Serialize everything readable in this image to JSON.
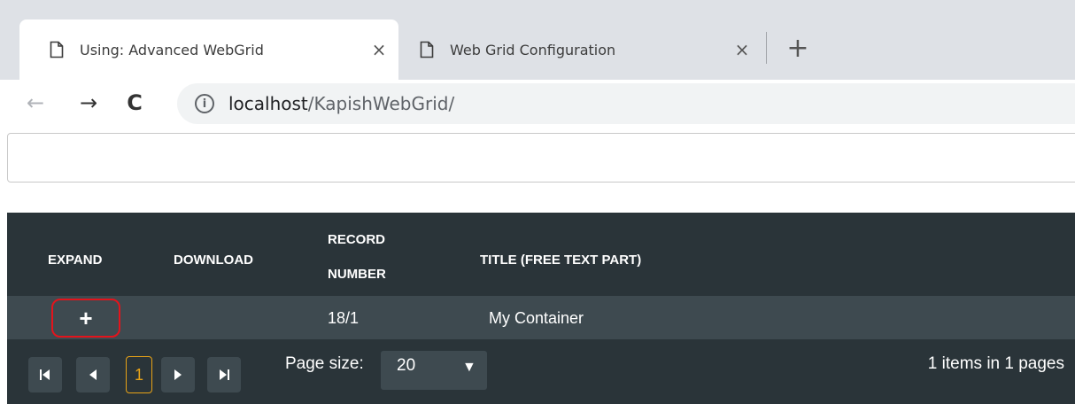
{
  "browser": {
    "tabs": [
      {
        "title": "Using: Advanced WebGrid",
        "close": "×",
        "active": true
      },
      {
        "title": "Web Grid Configuration",
        "close": "×",
        "active": false
      }
    ],
    "new_tab": "+",
    "nav": {
      "back": "←",
      "forward": "→",
      "reload": "C"
    },
    "address": {
      "info": "i",
      "host": "localhost",
      "path": "/KapishWebGrid/"
    }
  },
  "page": {
    "input": {
      "value": ""
    }
  },
  "grid": {
    "columns": [
      {
        "label": "EXPAND"
      },
      {
        "label": "DOWNLOAD"
      },
      {
        "label_line1": "RECORD",
        "label_line2": "NUMBER"
      },
      {
        "label": "TITLE (FREE TEXT PART)"
      }
    ],
    "rows": [
      {
        "expand": "+",
        "download": "",
        "record_number": "18/1",
        "title": "My Container"
      }
    ],
    "pager": {
      "first": "|◀",
      "prev": "◀",
      "current_page": "1",
      "next": "▶",
      "last": "▶|",
      "page_size_label": "Page size:",
      "page_size_value": "20",
      "dropdown_arrow": "▼",
      "info": "1 items in 1 pages"
    },
    "colors": {
      "background": "#2a3439",
      "row": "#3e4a50",
      "highlight": "#e3141c",
      "current_page": "#e8a317"
    }
  }
}
